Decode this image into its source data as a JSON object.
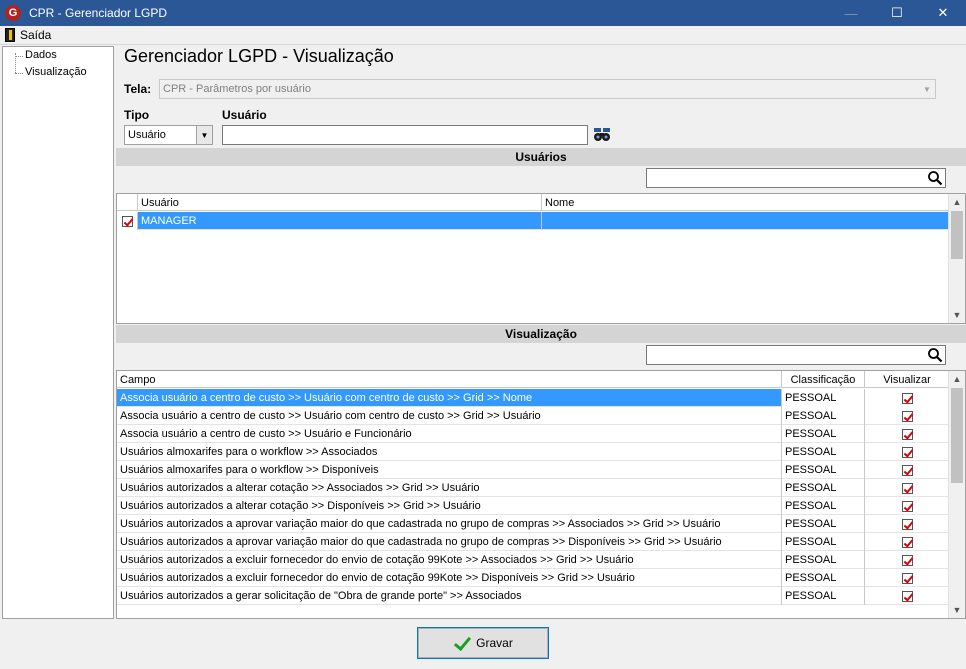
{
  "window": {
    "title": "CPR - Gerenciador LGPD",
    "app_icon_letter": "G"
  },
  "menu": {
    "exit_label": "Saída"
  },
  "sidebar": {
    "items": [
      {
        "label": "Dados"
      },
      {
        "label": "Visualização"
      }
    ]
  },
  "form": {
    "page_title": "Gerenciador LGPD - Visualização",
    "tela_label": "Tela:",
    "tela_value": "CPR - Parâmetros por usuário",
    "tipo_label": "Tipo",
    "tipo_value": "Usuário",
    "usuario_label": "Usuário",
    "usuario_value": ""
  },
  "users_section": {
    "header": "Usuários",
    "search_value": "",
    "columns": [
      "Usuário",
      "Nome"
    ],
    "rows": [
      {
        "usuario": "MANAGER",
        "nome": "",
        "checked": true
      }
    ]
  },
  "view_section": {
    "header": "Visualização",
    "search_value": "",
    "columns": [
      "Campo",
      "Classificação",
      "Visualizar"
    ],
    "rows": [
      {
        "campo": "Associa usuário a centro de custo >> Usuário com centro de custo >> Grid >> Nome",
        "classificacao": "PESSOAL",
        "visualizar": true
      },
      {
        "campo": "Associa usuário a centro de custo >> Usuário com centro de custo >> Grid >> Usuário",
        "classificacao": "PESSOAL",
        "visualizar": true
      },
      {
        "campo": "Associa usuário a centro de custo >> Usuário e Funcionário",
        "classificacao": "PESSOAL",
        "visualizar": true
      },
      {
        "campo": "Usuários almoxarifes para o workflow >> Associados",
        "classificacao": "PESSOAL",
        "visualizar": true
      },
      {
        "campo": "Usuários almoxarifes para o workflow >> Disponíveis",
        "classificacao": "PESSOAL",
        "visualizar": true
      },
      {
        "campo": "Usuários autorizados a alterar cotação >> Associados >> Grid >> Usuário",
        "classificacao": "PESSOAL",
        "visualizar": true
      },
      {
        "campo": "Usuários autorizados a alterar cotação >> Disponíveis >> Grid >> Usuário",
        "classificacao": "PESSOAL",
        "visualizar": true
      },
      {
        "campo": "Usuários autorizados a aprovar variação maior do que cadastrada no grupo de compras >> Associados >> Grid >> Usuário",
        "classificacao": "PESSOAL",
        "visualizar": true
      },
      {
        "campo": "Usuários autorizados a aprovar variação maior do que cadastrada no grupo de compras >> Disponíveis >> Grid >> Usuário",
        "classificacao": "PESSOAL",
        "visualizar": true
      },
      {
        "campo": "Usuários autorizados a excluir fornecedor do envio de cotação 99Kote >> Associados >> Grid >> Usuário",
        "classificacao": "PESSOAL",
        "visualizar": true
      },
      {
        "campo": "Usuários autorizados a excluir fornecedor do envio de cotação 99Kote >> Disponíveis >> Grid >> Usuário",
        "classificacao": "PESSOAL",
        "visualizar": true
      },
      {
        "campo": "Usuários autorizados a gerar solicitação de \"Obra de grande porte\" >> Associados",
        "classificacao": "PESSOAL",
        "visualizar": true
      }
    ]
  },
  "actions": {
    "save_label": "Gravar"
  },
  "colors": {
    "titlebar": "#2b5797",
    "selection": "#3399ff",
    "section_header": "#d4d4d4"
  }
}
